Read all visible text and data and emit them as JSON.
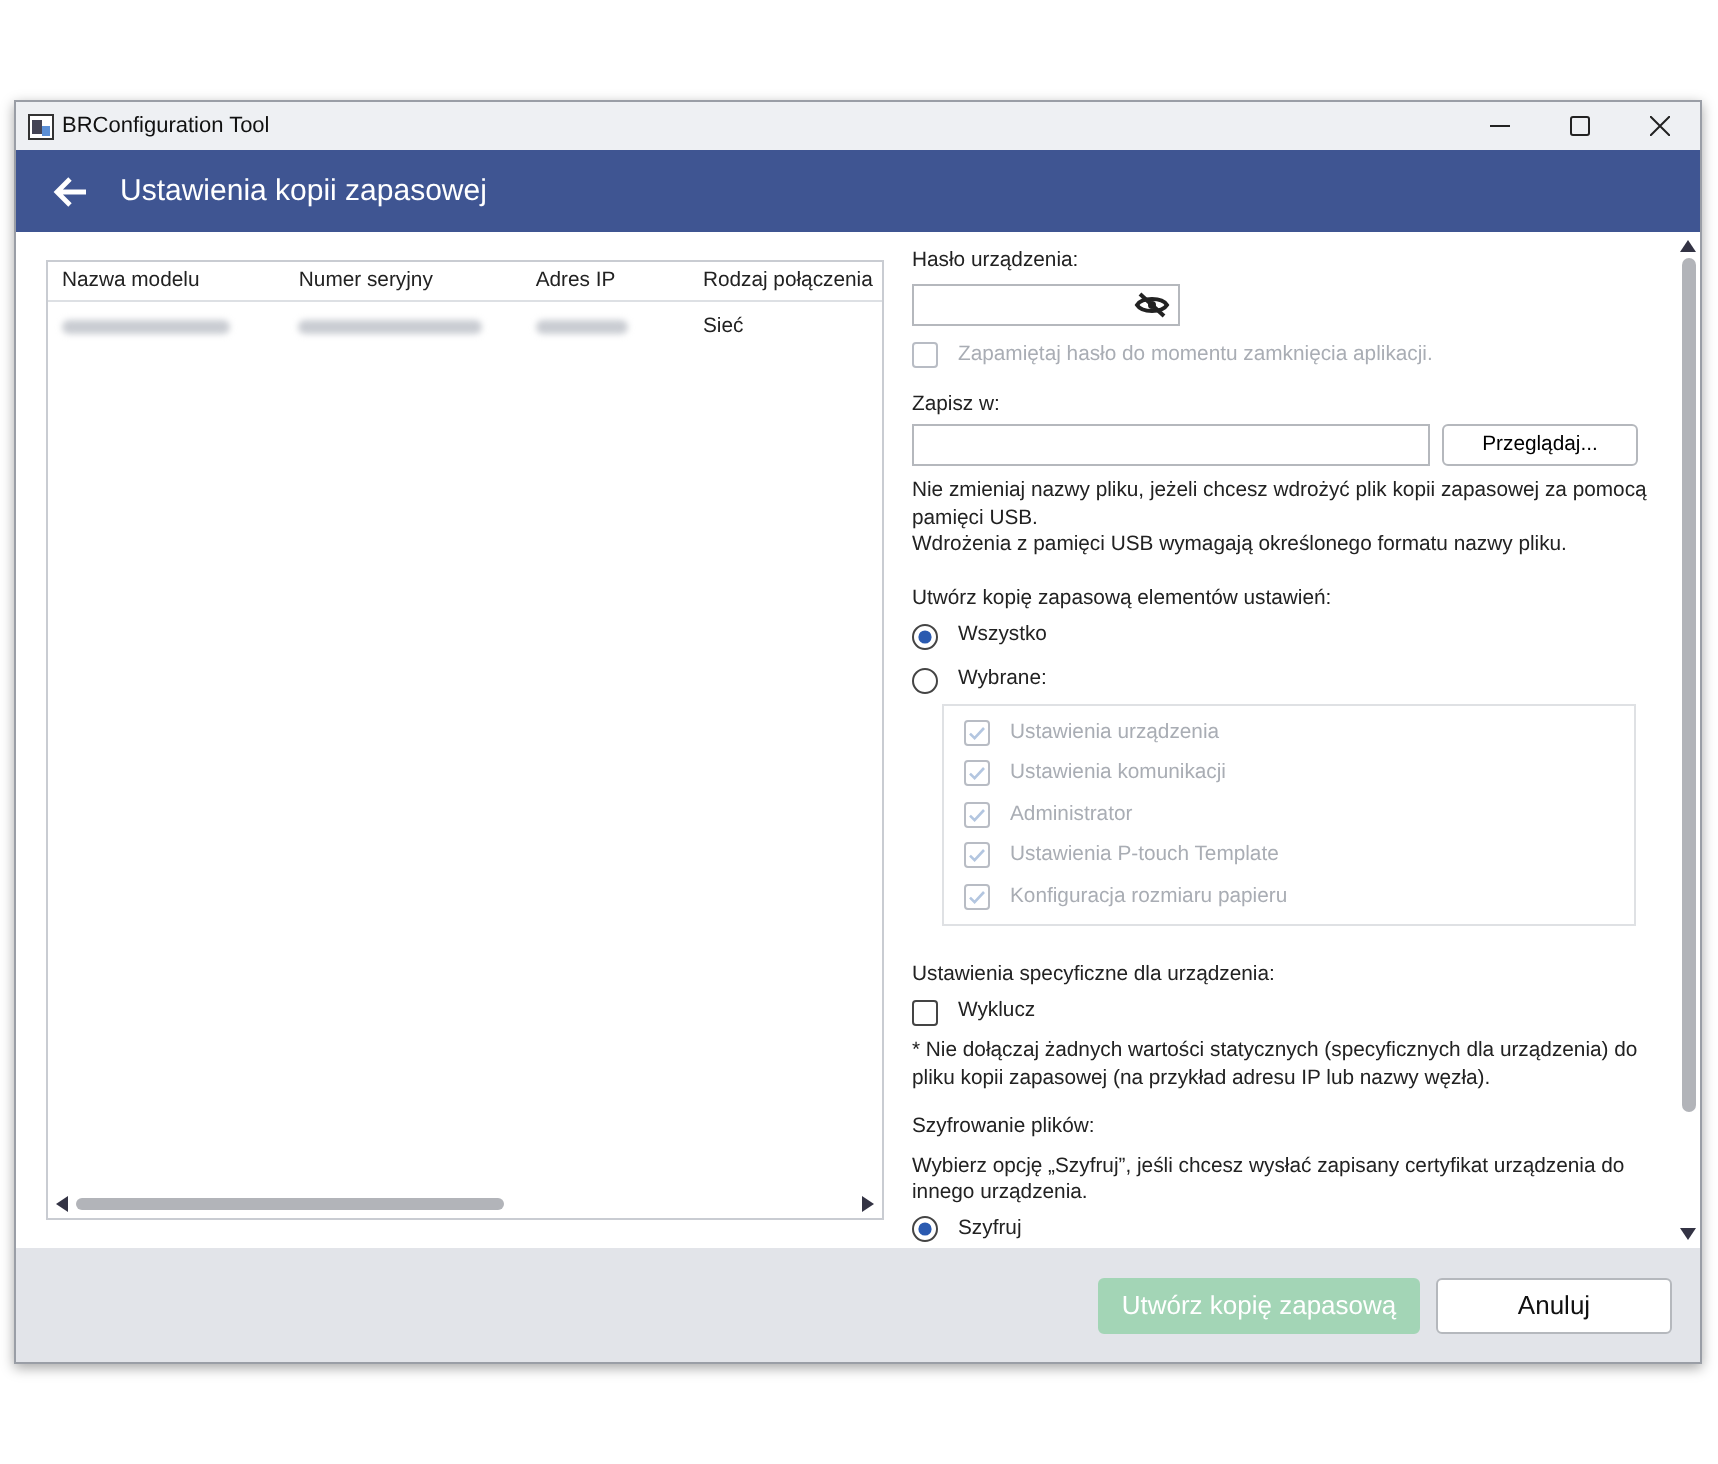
{
  "window": {
    "title": "BRConfiguration Tool"
  },
  "header": {
    "title": "Ustawienia kopii zapasowej"
  },
  "devices": {
    "columns": [
      "Nazwa modelu",
      "Numer seryjny",
      "Adres IP",
      "Rodzaj połączenia"
    ],
    "rows": [
      {
        "connection": "Sieć",
        "selected": false
      }
    ]
  },
  "password": {
    "label": "Hasło urządzenia:",
    "remember": {
      "label": "Zapamiętaj hasło do momentu zamknięcia aplikacji.",
      "checked": false,
      "disabled": true
    }
  },
  "save_to": {
    "label": "Zapisz w:",
    "browse": "Przeglądaj...",
    "notes": [
      "Nie zmieniaj nazwy pliku, jeżeli chcesz wdrożyć plik kopii zapasowej za pomocą pamięci USB.",
      "Wdrożenia z pamięci USB wymagają określonego formatu nazwy pliku."
    ]
  },
  "backup_items": {
    "label": "Utwórz kopię zapasową elementów ustawień:",
    "options": [
      {
        "label": "Wszystko",
        "selected": true
      },
      {
        "label": "Wybrane:",
        "selected": false
      }
    ],
    "items": [
      {
        "label": "Ustawienia urządzenia",
        "checked": true,
        "disabled": true
      },
      {
        "label": "Ustawienia komunikacji",
        "checked": true,
        "disabled": true
      },
      {
        "label": "Administrator",
        "checked": true,
        "disabled": true
      },
      {
        "label": "Ustawienia P-touch Template",
        "checked": true,
        "disabled": true
      },
      {
        "label": "Konfiguracja rozmiaru papieru",
        "checked": true,
        "disabled": true
      }
    ]
  },
  "device_specific": {
    "label": "Ustawienia specyficzne dla urządzenia:",
    "exclude": {
      "label": "Wyklucz",
      "checked": false,
      "disabled": false
    },
    "note": "* Nie dołączaj żadnych wartości statycznych (specyficznych dla urządzenia) do pliku kopii zapasowej (na przykład adresu IP lub nazwy węzła)."
  },
  "encryption": {
    "label": "Szyfrowanie plików:",
    "note": "Wybierz opcję „Szyfruj”, jeśli chcesz wysłać zapisany certyfikat urządzenia do innego urządzenia.",
    "options": [
      {
        "label": "Szyfruj",
        "selected": true
      }
    ]
  },
  "buttons": [
    {
      "label": "Utwórz kopię zapasową",
      "kind": "primary",
      "disabled": true
    },
    {
      "label": "Anuluj",
      "kind": "secondary",
      "disabled": false
    }
  ]
}
